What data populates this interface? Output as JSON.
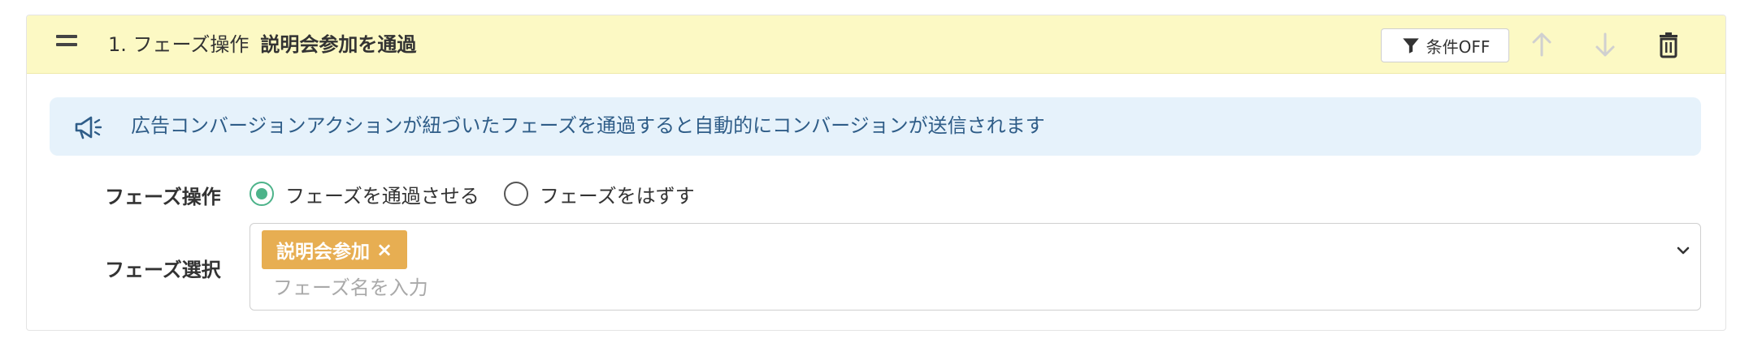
{
  "header": {
    "step_label": "1. フェーズ操作",
    "action_name": "説明会参加を通過",
    "condition_button_label": "条件OFF",
    "icons": {
      "drag": "drag-handle-icon",
      "filter": "filter-icon",
      "up": "arrow-up-icon",
      "down": "arrow-down-icon",
      "delete": "trash-icon"
    }
  },
  "info": {
    "icon": "megaphone-icon",
    "message": "広告コンバージョンアクションが紐づいたフェーズを通過すると自動的にコンバージョンが送信されます"
  },
  "phase_operation": {
    "label": "フェーズ操作",
    "options": [
      {
        "label": "フェーズを通過させる",
        "selected": true
      },
      {
        "label": "フェーズをはずす",
        "selected": false
      }
    ]
  },
  "phase_select": {
    "label": "フェーズ選択",
    "selected_tags": [
      {
        "label": "説明会参加",
        "remove": "×"
      }
    ],
    "placeholder": "フェーズ名を入力"
  },
  "colors": {
    "header_bg": "#fcf9c4",
    "info_bg": "#e6f2fb",
    "info_text": "#2f5d88",
    "tag_bg": "#e7ae52",
    "radio_accent": "#4db38a",
    "disabled_arrow": "#cfcfcf"
  }
}
